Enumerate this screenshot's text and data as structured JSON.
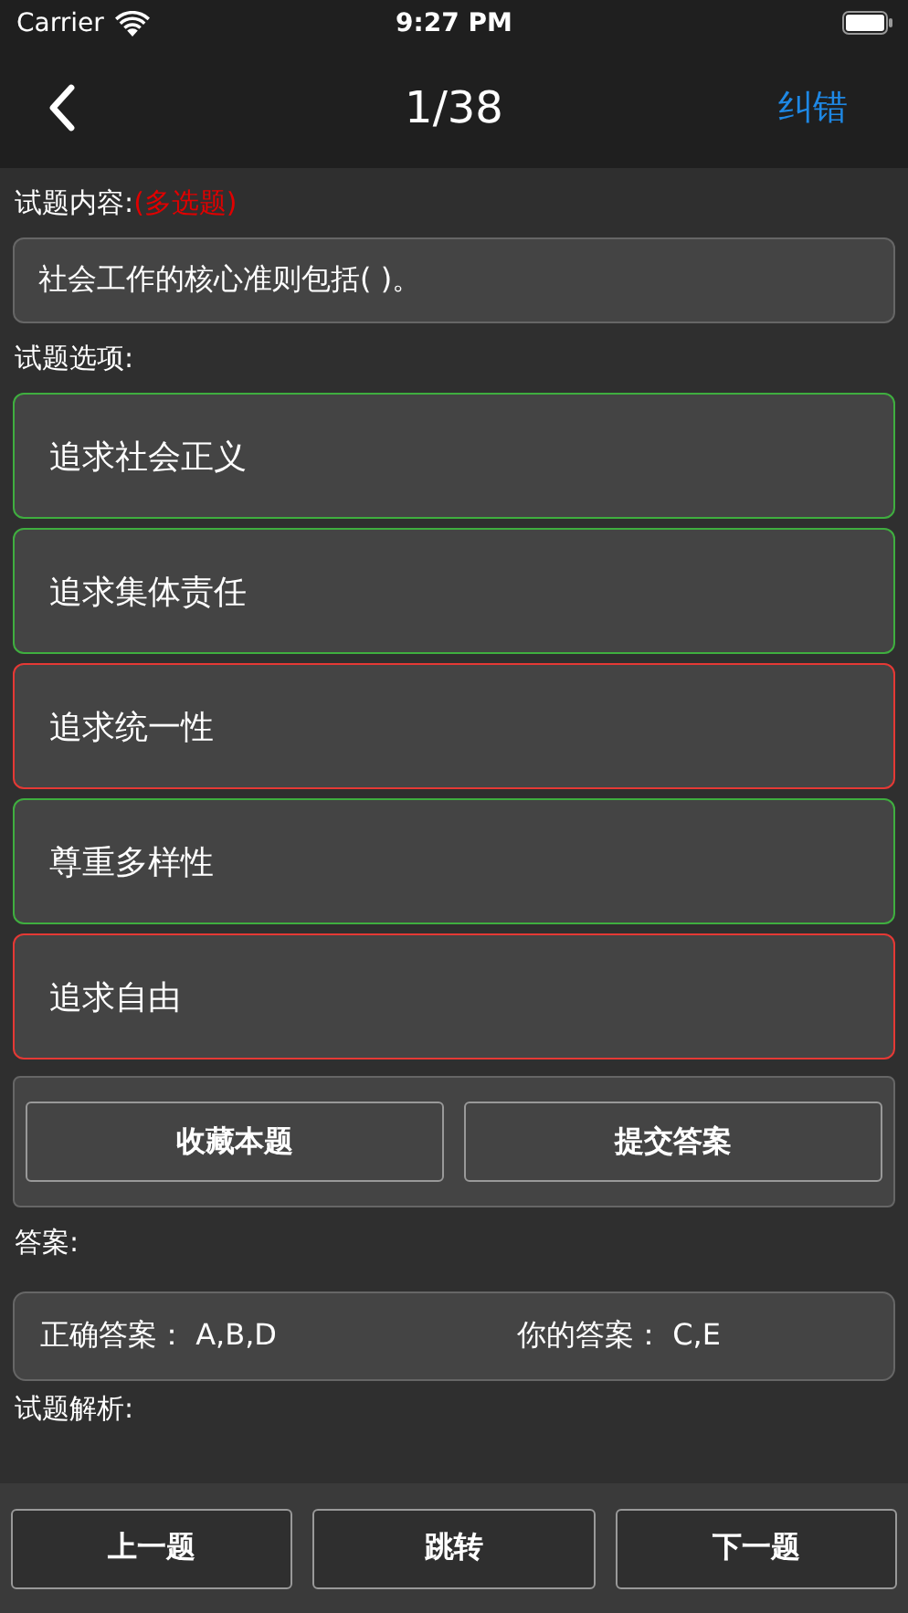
{
  "status_bar": {
    "carrier": "Carrier",
    "time": "9:27 PM"
  },
  "nav": {
    "title": "1/38",
    "action": "纠错"
  },
  "question": {
    "label": "试题内容:",
    "type": "(多选题)",
    "text": "社会工作的核心准则包括(   )。"
  },
  "options_label": "试题选项:",
  "options": [
    {
      "text": "追求社会正义",
      "correct": true
    },
    {
      "text": "追求集体责任",
      "correct": true
    },
    {
      "text": "追求统一性",
      "correct": false
    },
    {
      "text": "尊重多样性",
      "correct": true
    },
    {
      "text": "追求自由",
      "correct": false
    }
  ],
  "actions": [
    "收藏本题",
    "提交答案"
  ],
  "answer_label": "答案:",
  "answer": {
    "correct_label": "正确答案：",
    "correct": "A,B,D",
    "yours_label": "你的答案：",
    "yours": "C,E"
  },
  "analysis_label": "试题解析:",
  "bottom_buttons": [
    "上一题",
    "跳转",
    "下一题"
  ]
}
